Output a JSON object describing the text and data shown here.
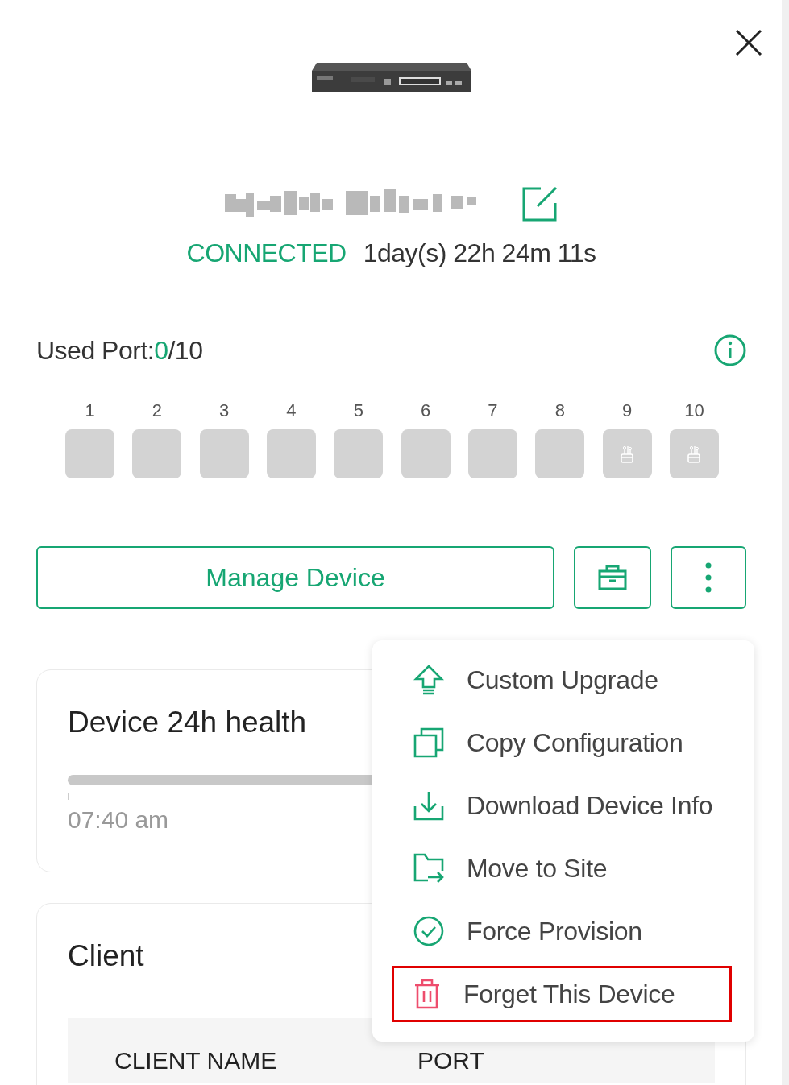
{
  "device": {
    "status": "CONNECTED",
    "uptime": "1day(s) 22h 24m 11s"
  },
  "ports": {
    "label": "Used Port:",
    "used": "0",
    "total": "/10",
    "items": [
      {
        "label": "1",
        "kind": "empty"
      },
      {
        "label": "2",
        "kind": "empty"
      },
      {
        "label": "3",
        "kind": "empty"
      },
      {
        "label": "4",
        "kind": "empty"
      },
      {
        "label": "5",
        "kind": "empty"
      },
      {
        "label": "6",
        "kind": "empty"
      },
      {
        "label": "7",
        "kind": "empty"
      },
      {
        "label": "8",
        "kind": "empty"
      },
      {
        "label": "9",
        "kind": "sfp"
      },
      {
        "label": "10",
        "kind": "sfp"
      }
    ]
  },
  "actions": {
    "primary": "Manage Device"
  },
  "menu": [
    {
      "label": "Custom Upgrade",
      "kind": "upgrade",
      "highlighted": false
    },
    {
      "label": "Copy Configuration",
      "kind": "copy",
      "highlighted": false
    },
    {
      "label": "Download Device Info",
      "kind": "download",
      "highlighted": false
    },
    {
      "label": "Move to Site",
      "kind": "move",
      "highlighted": false
    },
    {
      "label": "Force Provision",
      "kind": "provision",
      "highlighted": false
    },
    {
      "label": "Forget This Device",
      "kind": "forget",
      "highlighted": true
    }
  ],
  "health": {
    "title": "Device 24h health",
    "time": "07:40 am"
  },
  "client": {
    "title": "Client",
    "columns": [
      "CLIENT NAME",
      "PORT"
    ]
  }
}
